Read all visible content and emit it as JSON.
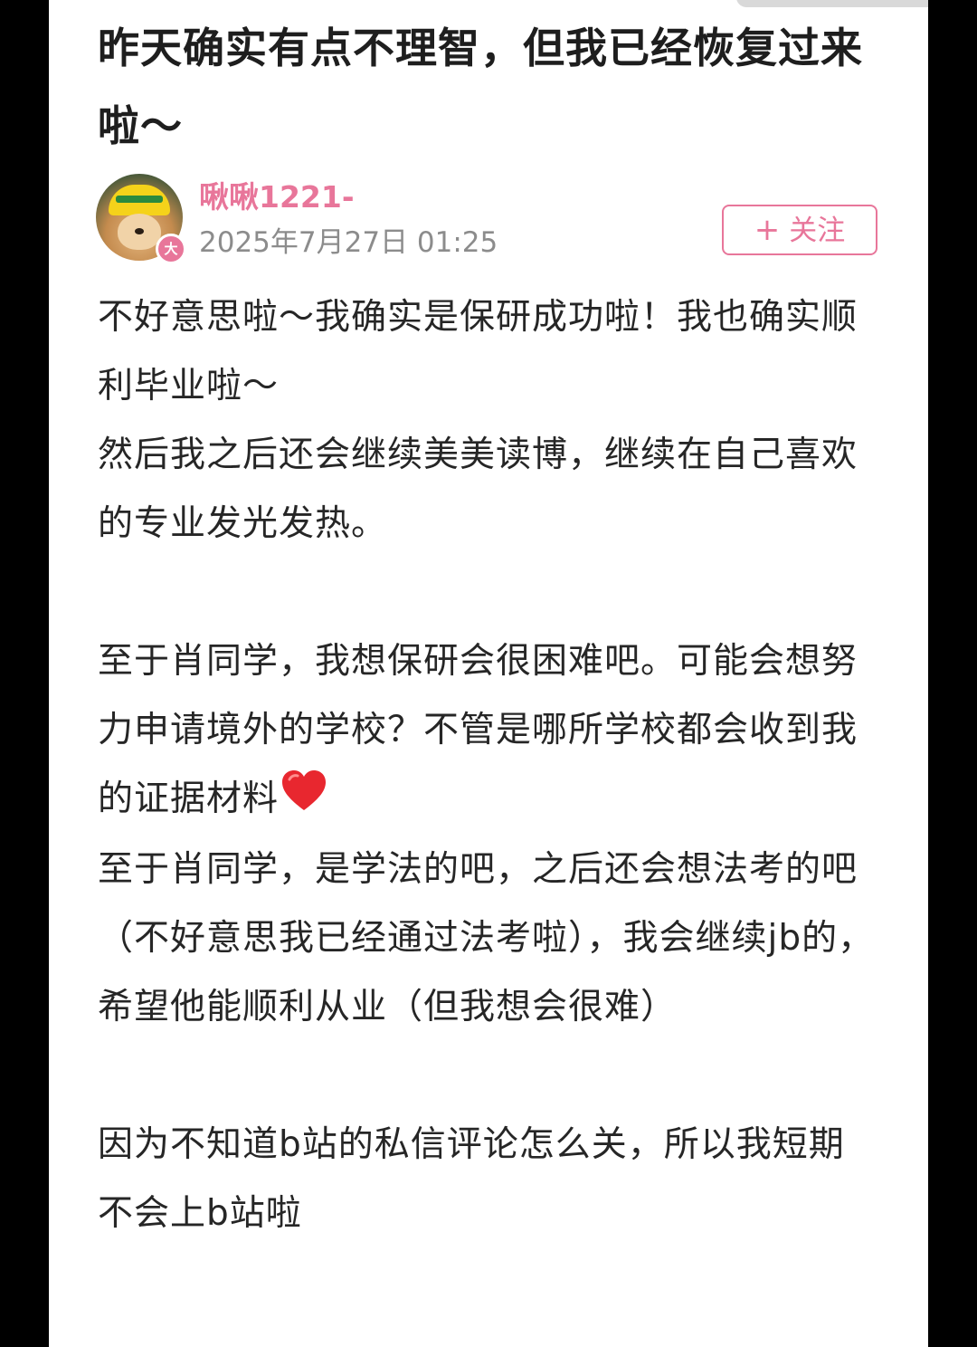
{
  "post": {
    "title": "昨天确实有点不理智，但我已经恢复过来啦～"
  },
  "author": {
    "name": "啾啾1221-",
    "level_badge": "大",
    "post_time": "2025年7月27日 01:25"
  },
  "follow_button": {
    "plus": "+",
    "label": "关注"
  },
  "body": {
    "p1": "不好意思啦～我确实是保研成功啦！我也确实顺利毕业啦～",
    "p2": "然后我之后还会继续美美读博，继续在自己喜欢的专业发光发热。",
    "p3": "至于肖同学，我想保研会很困难吧。可能会想努力申请境外的学校？不管是哪所学校都会收到我的证据材料",
    "p4": "至于肖同学，是学法的吧，之后还会想法考的吧（不好意思我已经通过法考啦），我会继续jb的，希望他能顺利从业（但我想会很难）",
    "p5": "因为不知道b站的私信评论怎么关，所以我短期不会上b站啦"
  },
  "icons": {
    "heart": "heart-icon",
    "avatar": "avatar-image"
  },
  "colors": {
    "accent": "#e8769a",
    "text": "#262626",
    "muted": "#8c8c8c"
  }
}
